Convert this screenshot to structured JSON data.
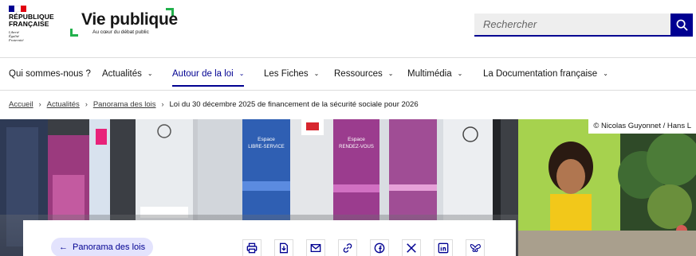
{
  "header": {
    "republique_lines": [
      "RÉPUBLIQUE",
      "FRANÇAISE"
    ],
    "devise_lines": [
      "Liberté",
      "Égalité",
      "Fraternité"
    ],
    "site_title": "Vie publique",
    "site_tagline": "Au cœur du débat public",
    "colors": {
      "blue": "#000091",
      "red": "#e1000f",
      "green": "#22b14c"
    }
  },
  "search": {
    "placeholder": "Rechercher",
    "icon": "search-icon"
  },
  "nav": {
    "items": [
      {
        "label": "Qui sommes-nous ?",
        "has_menu": false,
        "active": false
      },
      {
        "label": "Actualités",
        "has_menu": true,
        "active": false
      },
      {
        "label": "Autour de la loi",
        "has_menu": true,
        "active": true
      },
      {
        "label": "Les Fiches",
        "has_menu": true,
        "active": false
      },
      {
        "label": "Ressources",
        "has_menu": true,
        "active": false
      },
      {
        "label": "Multimédia",
        "has_menu": true,
        "active": false
      },
      {
        "label": "La Documentation française",
        "has_menu": true,
        "active": false
      }
    ]
  },
  "breadcrumb": {
    "items": [
      "Accueil",
      "Actualités",
      "Panorama des lois"
    ],
    "current": "Loi du 30 décembre 2025 de financement de la sécurité sociale pour 2026"
  },
  "hero": {
    "credit": "© Nicolas Guyonnet / Hans L",
    "signs": {
      "libre_service": [
        "Espace",
        "LIBRE-SERVICE"
      ],
      "rendez_vous": [
        "Espace",
        "RENDEZ-VOUS"
      ]
    }
  },
  "card": {
    "back_label": "Panorama des lois",
    "share_icons": [
      "print-icon",
      "download-icon",
      "mail-icon",
      "link-icon",
      "facebook-icon",
      "x-icon",
      "linkedin-icon",
      "bluesky-icon"
    ]
  }
}
